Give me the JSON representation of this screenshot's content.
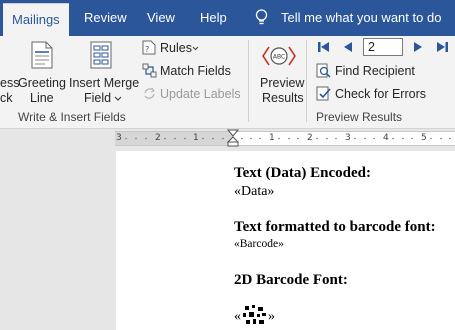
{
  "tabs": {
    "mailings": "Mailings",
    "review": "Review",
    "view": "View",
    "help": "Help",
    "tell_me": "Tell me what you want to do"
  },
  "ribbon": {
    "partial_1": "ess",
    "partial_2": "ck",
    "greeting_line": [
      "Greeting",
      "Line"
    ],
    "insert_merge_field": [
      "Insert Merge",
      "Field"
    ],
    "rules": "Rules",
    "match_fields": "Match Fields",
    "update_labels": "Update Labels",
    "preview_results": [
      "Preview",
      "Results"
    ],
    "record_number": "2",
    "find_recipient": "Find Recipient",
    "check_for_errors": "Check for Errors",
    "group_write_insert": "Write & Insert Fields",
    "group_preview": "Preview Results",
    "preview_icon_text": "ABC"
  },
  "ruler": {
    "marks": [
      "3",
      "2",
      "1",
      "1",
      "2",
      "3",
      "4",
      "5"
    ]
  },
  "document": {
    "heading1": "Text (Data) Encoded:",
    "field1": "«Data»",
    "heading2": "Text formatted to barcode font:",
    "field2": "«Barcode»",
    "heading3": "2D Barcode Font:",
    "barcode_open": "«",
    "barcode_close": "»"
  },
  "colors": {
    "ribbon_blue": "#2b579a",
    "ribbon_bg": "#f3f3f3",
    "nav_blue": "#2b579a"
  }
}
